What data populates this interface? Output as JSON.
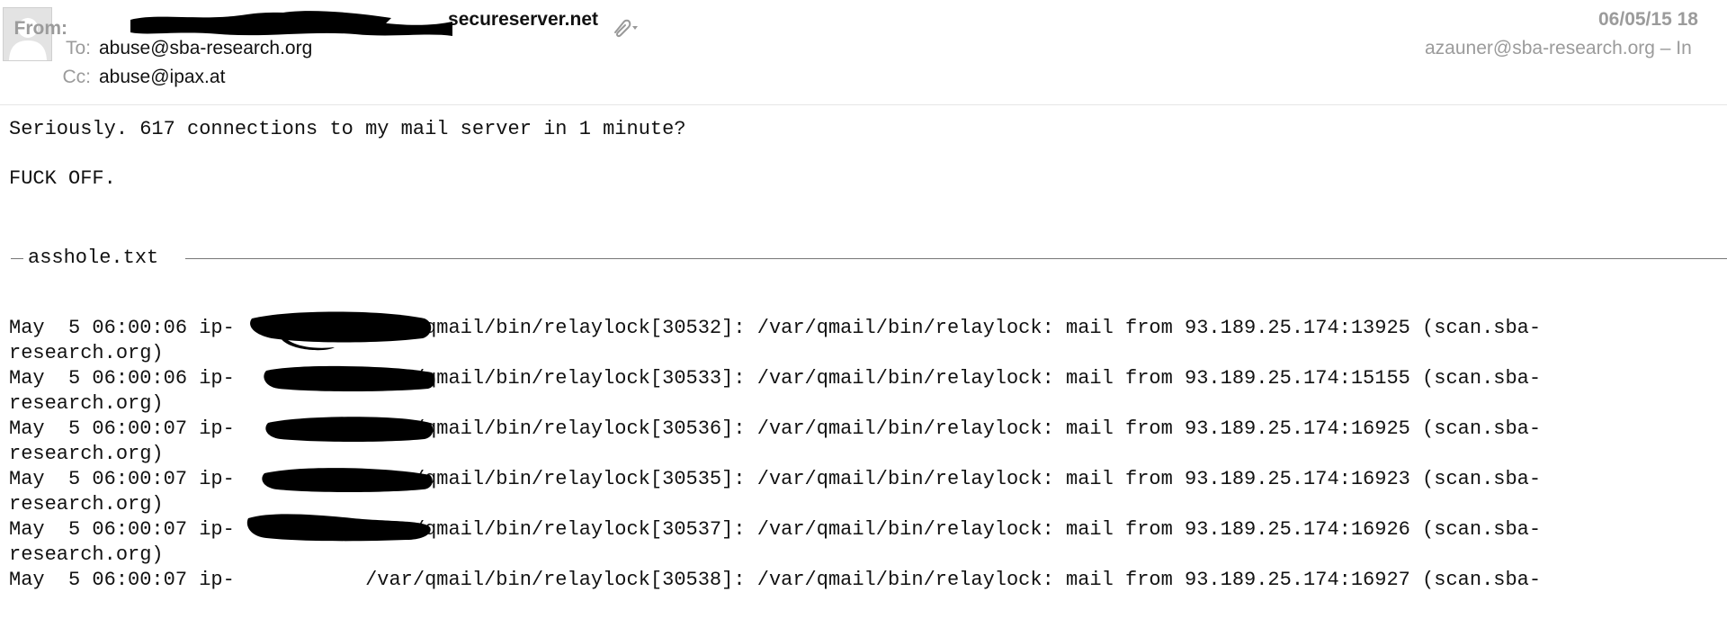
{
  "header": {
    "from_label": "From:",
    "sender_visible": "secureserver.net",
    "to_label": "To:",
    "to_value": "abuse@sba-research.org",
    "cc_label": "Cc:",
    "cc_value": "abuse@ipax.at",
    "date": "06/05/15 18",
    "recipient_account": "azauner@sba-research.org – In",
    "icons": {
      "avatar": "person-silhouette",
      "attachment": "paperclip-icon"
    }
  },
  "body": {
    "line1": "Seriously. 617 connections to my mail server in 1 minute?",
    "line2": "FUCK OFF."
  },
  "attachment": {
    "name": "asshole.txt"
  },
  "log": [
    {
      "line_a": "May  5 06:00:06 ip-           /var/qmail/bin/relaylock[30532]: /var/qmail/bin/relaylock: mail from 93.189.25.174:13925 (scan.sba-",
      "line_b": "research.org)"
    },
    {
      "line_a": "May  5 06:00:06 ip-           /var/qmail/bin/relaylock[30533]: /var/qmail/bin/relaylock: mail from 93.189.25.174:15155 (scan.sba-",
      "line_b": "research.org)"
    },
    {
      "line_a": "May  5 06:00:07 ip-           /var/qmail/bin/relaylock[30536]: /var/qmail/bin/relaylock: mail from 93.189.25.174:16925 (scan.sba-",
      "line_b": "research.org)"
    },
    {
      "line_a": "May  5 06:00:07 ip-           /var/qmail/bin/relaylock[30535]: /var/qmail/bin/relaylock: mail from 93.189.25.174:16923 (scan.sba-",
      "line_b": "research.org)"
    },
    {
      "line_a": "May  5 06:00:07 ip-           /var/qmail/bin/relaylock[30537]: /var/qmail/bin/relaylock: mail from 93.189.25.174:16926 (scan.sba-",
      "line_b": "research.org)"
    },
    {
      "line_a": "May  5 06:00:07 ip-           /var/qmail/bin/relaylock[30538]: /var/qmail/bin/relaylock: mail from 93.189.25.174:16927 (scan.sba-",
      "line_b": ""
    }
  ],
  "colors": {
    "label_gray": "#9b9b9b",
    "text": "#111111",
    "redaction": "#000000"
  }
}
